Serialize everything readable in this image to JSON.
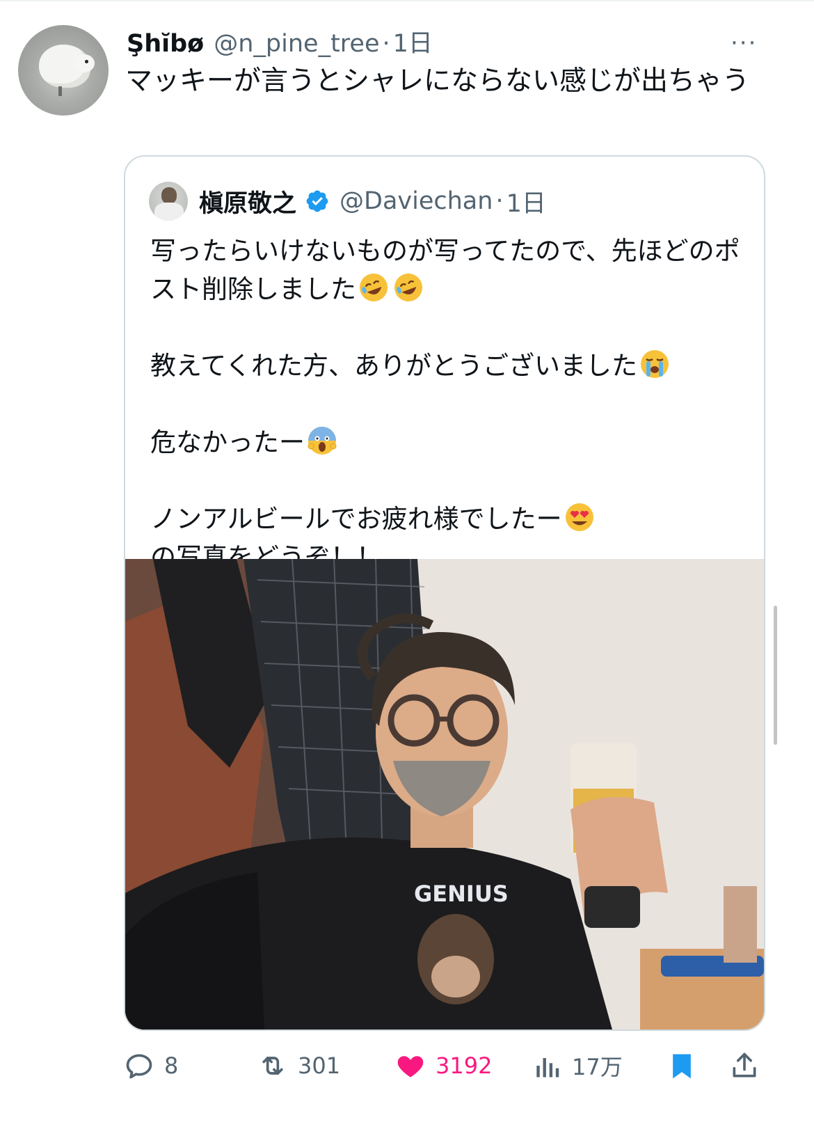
{
  "tweet": {
    "author_name": "Şhĭbø",
    "handle": "@n_pine_tree",
    "separator": "·",
    "time": "1日",
    "more": "···",
    "text": "マッキーが言うとシャレにならない感じが出ちゃう"
  },
  "quote": {
    "author_name": "槇原敬之",
    "verified": true,
    "handle": "@Daviechan",
    "separator": "·",
    "time": "1日",
    "paragraphs": [
      "写ったらいけないものが写ってたので、先ほどのポスト削除しました",
      "教えてくれた方、ありがとうございました",
      "危なかったー",
      "ノンアルビールでお疲れ様でしたー",
      "の写真をどうぞ！！"
    ],
    "photo_shirt_text": "GENIUS"
  },
  "actions": {
    "replies": "8",
    "retweets": "301",
    "likes": "3192",
    "views": "17万"
  },
  "colors": {
    "text": "#0f1419",
    "secondary": "#536471",
    "like": "#f91880",
    "bookmark": "#1d9bf0",
    "border": "#cfd9de"
  }
}
